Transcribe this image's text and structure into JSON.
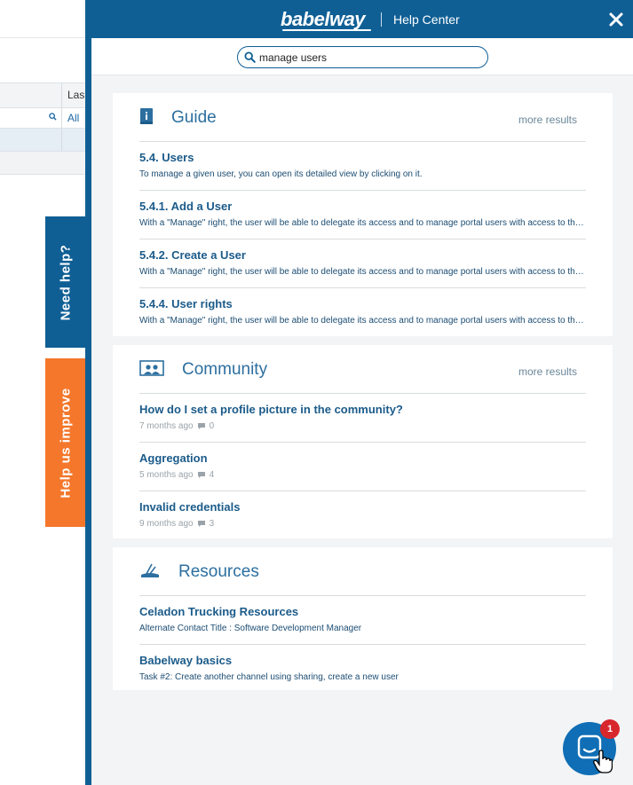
{
  "background_app": {
    "column_header": "Las",
    "filter_value": "All"
  },
  "side_tabs": {
    "need_help": "Need help?",
    "help_us_improve": "Help us improve"
  },
  "header": {
    "logo": "babelway",
    "title": "Help Center"
  },
  "search": {
    "value": "manage users",
    "placeholder": ""
  },
  "guide": {
    "title": "Guide",
    "more_results": "more results",
    "items": [
      {
        "title": "5.4. Users",
        "desc": "To manage a given user, you can open its  detailed view  by clicking on it."
      },
      {
        "title": "5.4.1. Add a User",
        "desc": "With a \"Manage\" right, the user will be able to delegate its access and to manage portal users with access to the companies"
      },
      {
        "title": "5.4.2. Create a User",
        "desc": "With a \"Manage\" right, the user will be able to delegate its access and to manage portal users with access to the companies"
      },
      {
        "title": "5.4.4. User rights",
        "desc": "With a \"Manage\" right, the user will be able to delegate its access and to manage portal users with access to the companies"
      }
    ]
  },
  "community": {
    "title": "Community",
    "more_results": "more results",
    "items": [
      {
        "title": "How do I set a profile picture in the community?",
        "age": "7 months ago",
        "comments": "0"
      },
      {
        "title": "Aggregation",
        "age": "5 months ago",
        "comments": "4"
      },
      {
        "title": "Invalid credentials",
        "age": "9 months ago",
        "comments": "3"
      }
    ]
  },
  "resources": {
    "title": "Resources",
    "items": [
      {
        "title": "Celadon Trucking Resources",
        "desc": "Alternate Contact Title : Software Development Manager"
      },
      {
        "title": "Babelway basics",
        "desc": "Task #2: Create another channel using sharing, create a new user"
      }
    ]
  },
  "chat": {
    "badge_count": "1"
  },
  "colors": {
    "brand_blue": "#0f5f95",
    "improve_orange": "#f4772b",
    "badge_red": "#d8262d"
  }
}
